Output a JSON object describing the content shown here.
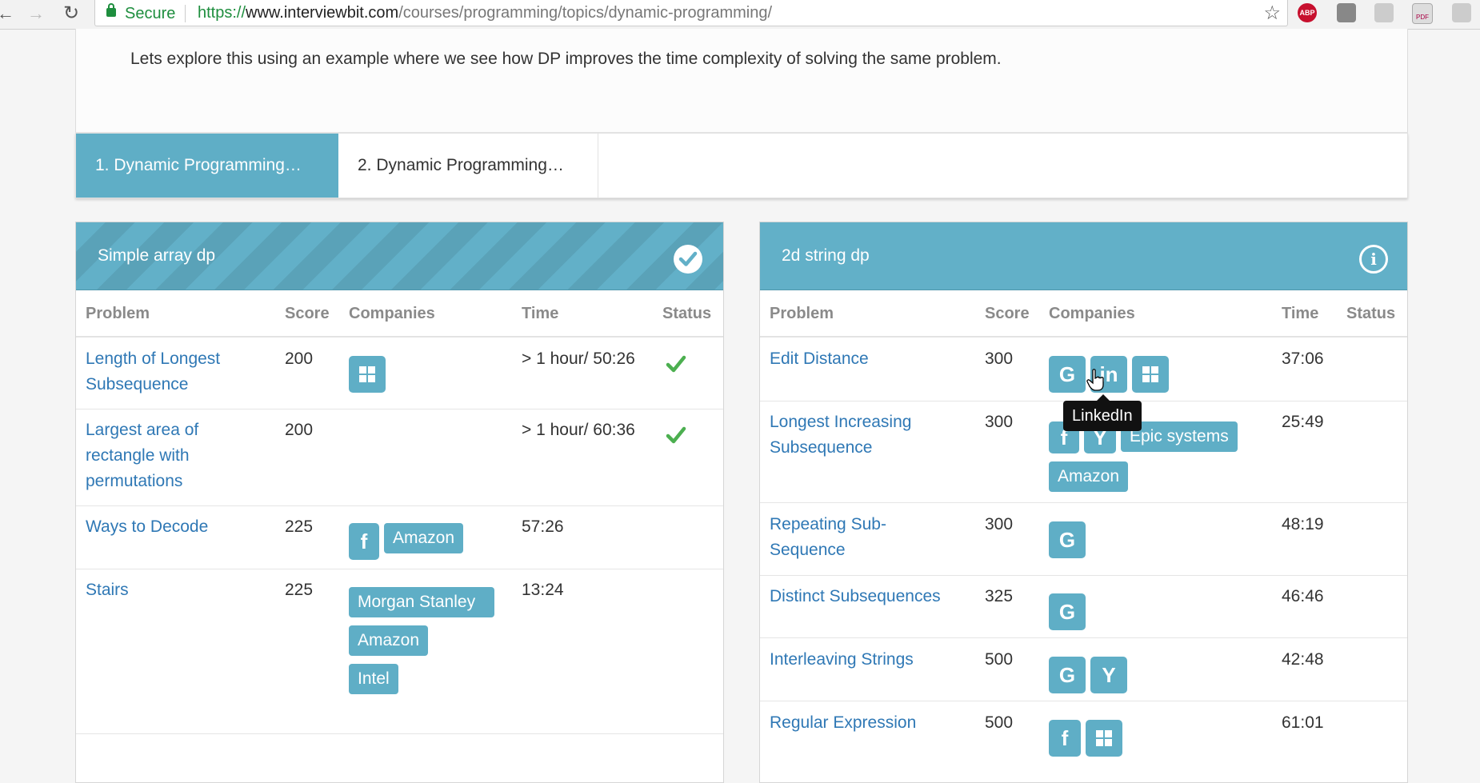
{
  "browser": {
    "secure_label": "Secure",
    "url_scheme": "https://",
    "url_host": "www.interviewbit.com",
    "url_path": "/courses/programming/topics/dynamic-programming/",
    "abp_label": "ABP",
    "pdf_label": "PDF"
  },
  "intro": {
    "text": "Lets explore this using an example where we see how DP improves the time complexity of solving the same problem."
  },
  "tabs": [
    {
      "label": "1. Dynamic Programming…",
      "active": true
    },
    {
      "label": "2. Dynamic Programming…",
      "active": false
    }
  ],
  "columns": {
    "problem": "Problem",
    "score": "Score",
    "companies": "Companies",
    "time": "Time",
    "status": "Status"
  },
  "left_panel": {
    "title": "Simple array dp",
    "status_icon": "check-circle-icon",
    "rows": [
      {
        "problem": "Length of Longest Subsequence",
        "score": "200",
        "time": "> 1 hour/ 50:26",
        "solved": true,
        "companies": [
          "Microsoft"
        ]
      },
      {
        "problem": "Largest area of rectangle with permutations",
        "score": "200",
        "time": "> 1 hour/ 60:36",
        "solved": true,
        "companies": []
      },
      {
        "problem": "Ways to Decode",
        "score": "225",
        "time": "57:26",
        "solved": false,
        "companies": [
          "Facebook",
          "Amazon"
        ]
      },
      {
        "problem": "Stairs",
        "score": "225",
        "time": "13:24",
        "solved": false,
        "companies": [
          "Morgan Stanley",
          "Amazon",
          "Intel"
        ]
      }
    ]
  },
  "right_panel": {
    "title": "2d string dp",
    "status_icon": "info-icon",
    "info_glyph": "i",
    "rows": [
      {
        "problem": "Edit Distance",
        "score": "300",
        "time": "37:06",
        "companies": [
          "Google",
          "LinkedIn",
          "Microsoft"
        ]
      },
      {
        "problem": "Longest Increasing Subsequence",
        "score": "300",
        "time": "25:49",
        "companies": [
          "Facebook",
          "Yahoo",
          "Epic systems",
          "Amazon"
        ]
      },
      {
        "problem": "Repeating Sub-Sequence",
        "score": "300",
        "time": "48:19",
        "companies": [
          "Google"
        ]
      },
      {
        "problem": "Distinct Subsequences",
        "score": "325",
        "time": "46:46",
        "companies": [
          "Google"
        ]
      },
      {
        "problem": "Interleaving Strings",
        "score": "500",
        "time": "42:48",
        "companies": [
          "Google",
          "Yahoo"
        ]
      },
      {
        "problem": "Regular Expression",
        "score": "500",
        "time": "61:01",
        "companies": [
          "Facebook",
          "Microsoft"
        ]
      }
    ]
  },
  "company_labels": {
    "Amazon": "Amazon",
    "Morgan Stanley": "Morgan Stanley",
    "Intel": "Intel",
    "Epic systems": "Epic systems"
  },
  "company_glyphs": {
    "Google": "G",
    "Facebook": "f",
    "Yahoo": "Y",
    "LinkedIn": "in"
  },
  "tooltip": {
    "text": "LinkedIn"
  },
  "colors": {
    "accent": "#5faec6",
    "link": "#2f78b5",
    "check": "#4caf50",
    "secure": "#1e8e3e"
  }
}
